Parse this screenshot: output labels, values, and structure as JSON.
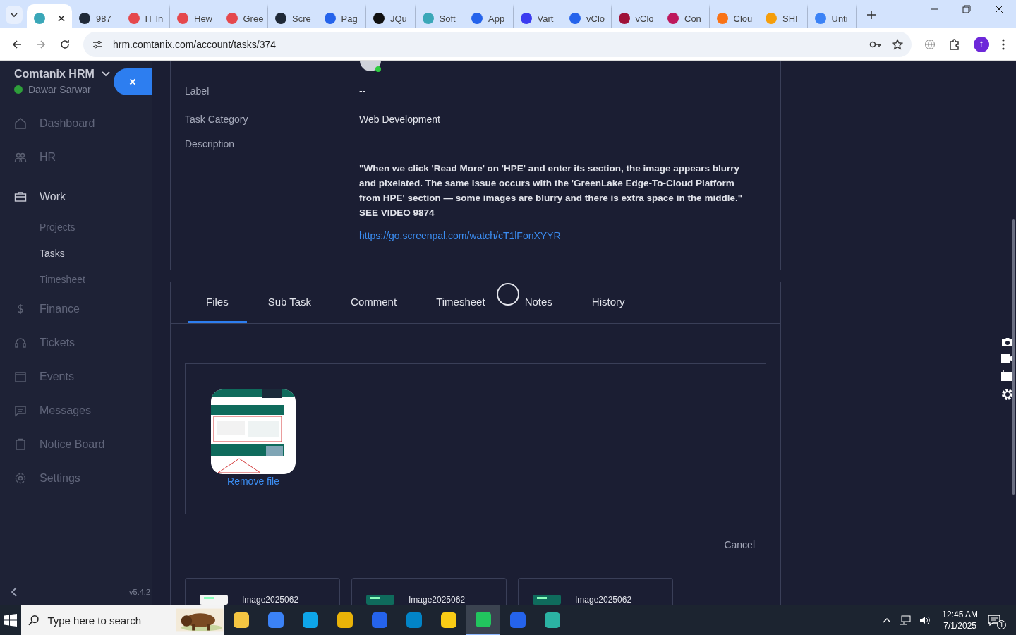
{
  "browser": {
    "tabs": [
      {
        "selected": true,
        "color": "#3aa7b8"
      },
      {
        "title": "987",
        "selected": false,
        "color": "#1f2937"
      },
      {
        "title": "IT In",
        "selected": false,
        "color": "#e5484d"
      },
      {
        "title": "Hew",
        "selected": false,
        "color": "#e5484d"
      },
      {
        "title": "Gree",
        "selected": false,
        "color": "#e5484d"
      },
      {
        "title": "Scre",
        "selected": false,
        "color": "#1f2937"
      },
      {
        "title": "Pag",
        "selected": false,
        "color": "#2563eb"
      },
      {
        "title": "JQu",
        "selected": false,
        "color": "#111111"
      },
      {
        "title": "Soft",
        "selected": false,
        "color": "#3aa7b8"
      },
      {
        "title": "App",
        "selected": false,
        "color": "#2563eb"
      },
      {
        "title": "Vart",
        "selected": false,
        "color": "#3b3bf0"
      },
      {
        "title": "vClo",
        "selected": false,
        "color": "#2563eb"
      },
      {
        "title": "vClo",
        "selected": false,
        "color": "#9f1239"
      },
      {
        "title": "Con",
        "selected": false,
        "color": "#be185d"
      },
      {
        "title": "Clou",
        "selected": false,
        "color": "#f97316"
      },
      {
        "title": "SHI",
        "selected": false,
        "color": "#f59e0b"
      },
      {
        "title": "Unti",
        "selected": false,
        "color": "#3b82f6"
      }
    ],
    "address": "hrm.comtanix.com/account/tasks/374",
    "profile": "t"
  },
  "sidebar": {
    "brand": "Comtanix HRM",
    "user": "Dawar Sarwar",
    "online": true,
    "items": [
      {
        "label": "Dashboard",
        "expanded": false
      },
      {
        "label": "HR",
        "expanded": false
      },
      {
        "label": "Work",
        "expanded": true,
        "children": [
          {
            "label": "Projects",
            "selected": false
          },
          {
            "label": "Tasks",
            "selected": true
          },
          {
            "label": "Timesheet",
            "selected": false
          }
        ]
      },
      {
        "label": "Finance",
        "expanded": false
      },
      {
        "label": "Tickets",
        "expanded": false
      },
      {
        "label": "Events",
        "expanded": false
      },
      {
        "label": "Messages",
        "expanded": false
      },
      {
        "label": "Notice Board",
        "expanded": false
      },
      {
        "label": "Settings",
        "expanded": false
      }
    ],
    "version": "v5.4.2"
  },
  "details": [
    {
      "kind": "text",
      "label": "Label",
      "value": "--"
    },
    {
      "kind": "text",
      "label": "Task Category",
      "value": "Web Development"
    },
    {
      "kind": "description",
      "label": "Description",
      "value": "\"When we click 'Read More' on 'HPE' and enter its section, the image appears blurry and pixelated. The same issue occurs with the 'GreenLake Edge-To-Cloud Platform from HPE' section — some images are blurry and there is extra space in the middle.\" SEE VIDEO 9874",
      "link": "https://go.screenpal.com/watch/cT1lFonXYYR"
    }
  ],
  "tabs": [
    {
      "label": "Files",
      "selected": true
    },
    {
      "label": "Sub Task",
      "selected": false
    },
    {
      "label": "Comment",
      "selected": false
    },
    {
      "label": "Timesheet",
      "selected": false
    },
    {
      "label": "Notes",
      "selected": false
    },
    {
      "label": "History",
      "selected": false
    }
  ],
  "loading": true,
  "files": {
    "uploads": [
      {
        "kind": "picture",
        "action": "Remove file"
      }
    ],
    "cancel": "Cancel",
    "attachments": [
      {
        "name": "Image2025062"
      },
      {
        "name": "Image2025062"
      },
      {
        "name": "Image2025062"
      }
    ]
  },
  "taskbar": {
    "search_placeholder": "Type here to search",
    "apps": [
      {
        "selected": false
      },
      {
        "selected": false
      },
      {
        "selected": false
      },
      {
        "selected": false
      },
      {
        "selected": false
      },
      {
        "selected": false
      },
      {
        "selected": false
      },
      {
        "selected": true
      },
      {
        "selected": false
      },
      {
        "selected": false
      }
    ],
    "time": "12:45 AM",
    "date": "7/1/2025",
    "notifications": "1"
  }
}
